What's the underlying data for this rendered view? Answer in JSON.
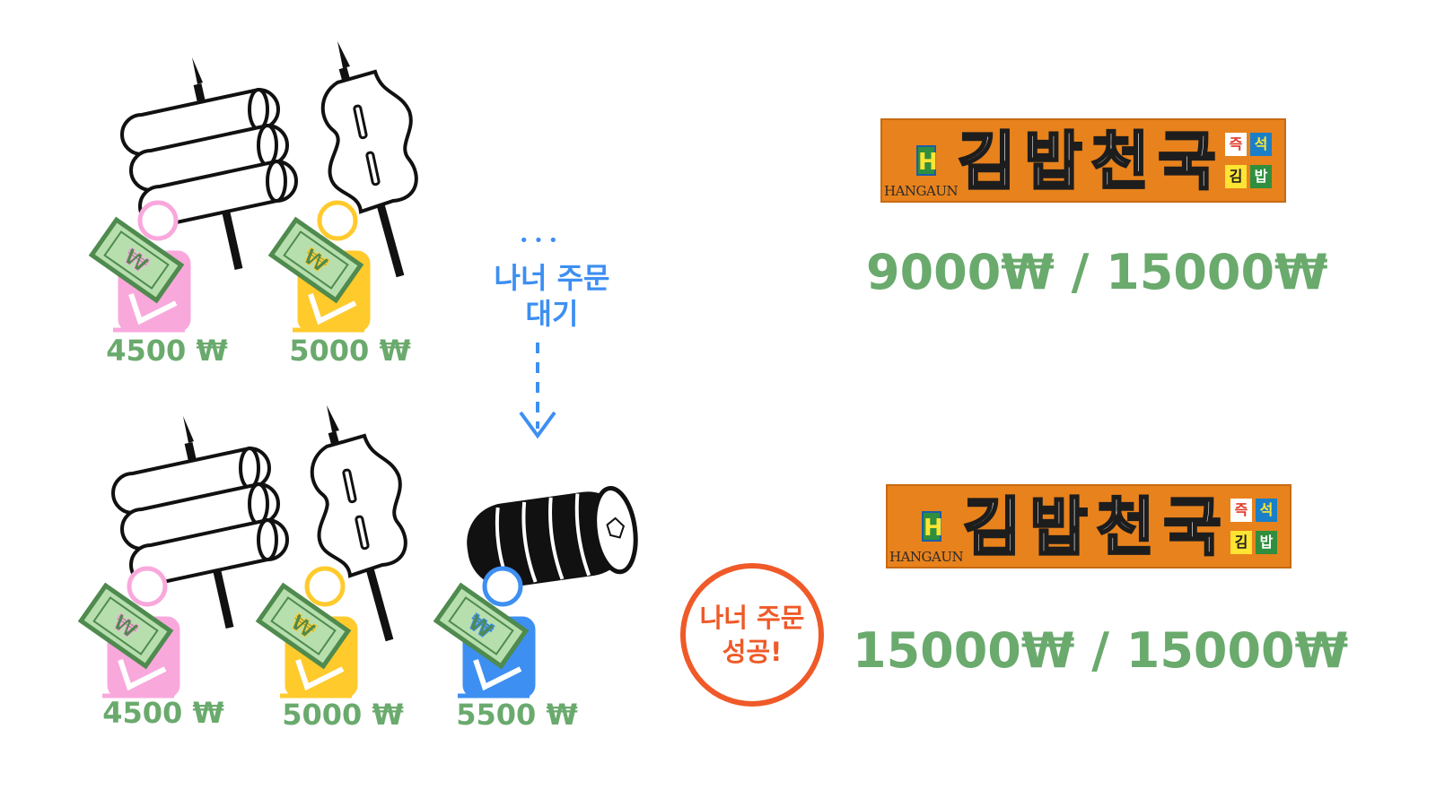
{
  "top_row": {
    "prices": [
      "4500 ₩",
      "5000 ₩"
    ],
    "wait_dots": "• • •",
    "wait_text_line1": "나너 주문",
    "wait_text_line2": "대기",
    "sign": {
      "brand_small": "HANGAUN",
      "brand_big": "김밥천국",
      "logo_letter": "H",
      "tags": [
        "즉",
        "석",
        "김",
        "밥"
      ]
    },
    "total": "9000₩ / 15000₩"
  },
  "bottom_row": {
    "prices": [
      "4500 ₩",
      "5000 ₩",
      "5500 ₩"
    ],
    "success_line1": "나너 주문",
    "success_line2": "성공!",
    "sign": {
      "brand_small": "HANGAUN",
      "brand_big": "김밥천국",
      "logo_letter": "H",
      "tags": [
        "즉",
        "석",
        "김",
        "밥"
      ]
    },
    "total": "15000₩ / 15000₩"
  },
  "colors": {
    "pink": "#f9a8dc",
    "yellow": "#ffca2c",
    "blue": "#3d8ff2",
    "price_green": "#6aaa6d",
    "success_red": "#ef5a28",
    "sign_orange": "#e8821c"
  },
  "icons": {
    "fishcake_skewer": "fishcake-skewer-icon",
    "eomuk_skewer": "eomuk-skewer-icon",
    "gimbap_roll": "gimbap-roll-icon",
    "person": "person-icon",
    "money_bill": "money-bill-icon"
  }
}
